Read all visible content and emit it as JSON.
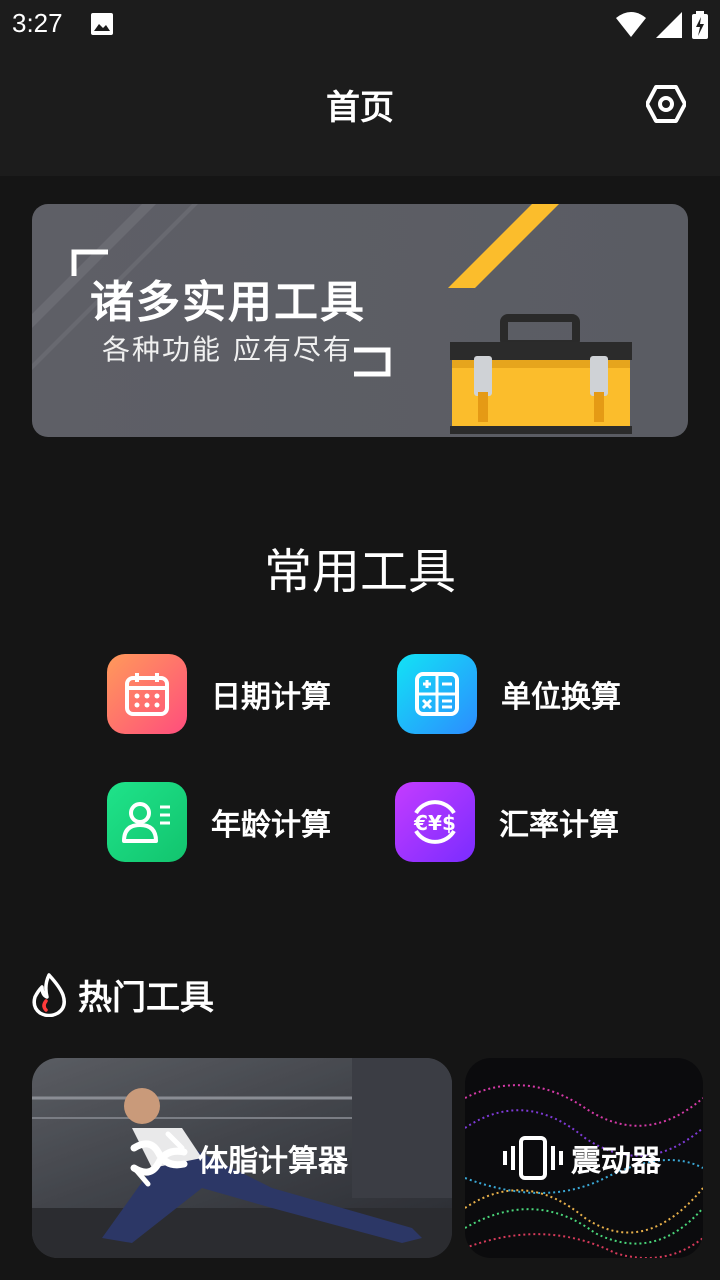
{
  "status_bar": {
    "time": "3:27"
  },
  "app_bar": {
    "title": "首页",
    "settings_icon": "settings-hexagon-icon"
  },
  "banner": {
    "title": "诸多实用工具",
    "subtitle": "各种功能   应有尽有",
    "accent_color": "#fbbd2c"
  },
  "common_tools": {
    "title": "常用工具",
    "items": [
      {
        "label": "日期计算",
        "icon": "calendar-icon",
        "gradient": [
          "#ff9a5a",
          "#ff4d7d"
        ]
      },
      {
        "label": "单位换算",
        "icon": "calculator-icon",
        "gradient": [
          "#12e3f5",
          "#2c8cff"
        ]
      },
      {
        "label": "年龄计算",
        "icon": "person-card-icon",
        "gradient": [
          "#1fe38a",
          "#12c46e"
        ]
      },
      {
        "label": "汇率计算",
        "icon": "currency-exchange-icon",
        "gradient": [
          "#c43cff",
          "#7a2cff"
        ]
      }
    ]
  },
  "hot_tools": {
    "title": "热门工具",
    "icon": "flame-icon",
    "cards": [
      {
        "label": "体脂计算器",
        "icon": "body-fat-icon"
      },
      {
        "label": "震动器",
        "icon": "vibrate-icon"
      }
    ]
  }
}
